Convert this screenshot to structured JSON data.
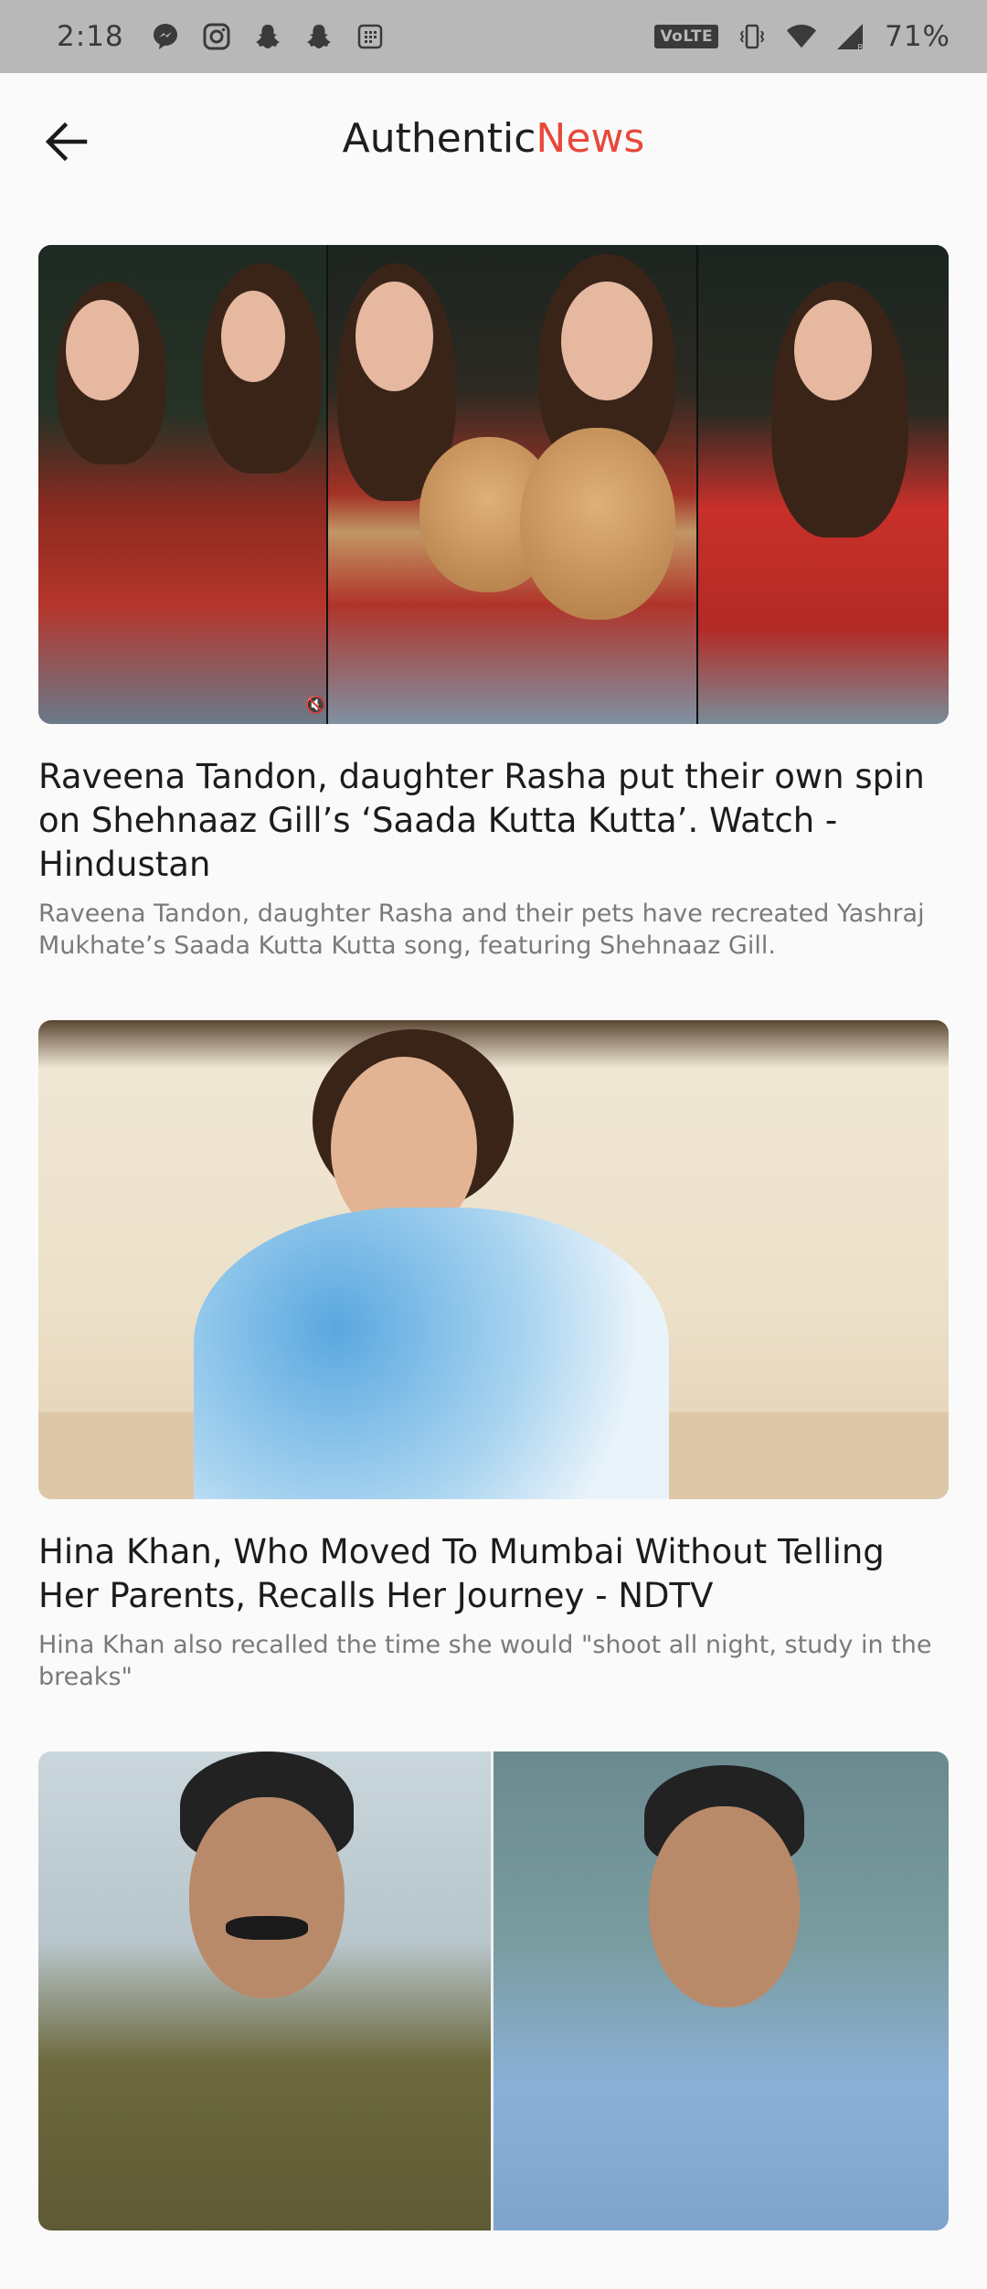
{
  "status_bar": {
    "time": "2:18",
    "volte": "VoLTE",
    "battery": "71%",
    "left_icons": [
      "messenger-icon",
      "instagram-icon",
      "snapchat-icon",
      "snapchat-icon",
      "app-grid-icon"
    ],
    "right_icons": [
      "volte-icon",
      "vibrate-icon",
      "wifi-icon",
      "signal-icon"
    ]
  },
  "app_bar": {
    "brand_part1": "Authentic",
    "brand_part2": "News",
    "accent_color": "#e8483a",
    "back_icon": "arrow-left-icon"
  },
  "articles": [
    {
      "title": "Raveena Tandon, daughter Rasha put their own spin on Shehnaaz Gill’s ‘Saada Kutta Kutta’. Watch - Hindustan",
      "description": "Raveena Tandon, daughter Rasha and their pets have recreated Yashraj Mukhate’s Saada Kutta Kutta song, featuring Shehnaaz Gill."
    },
    {
      "title": "Hina Khan, Who Moved To Mumbai Without Telling Her Parents, Recalls Her Journey - NDTV",
      "description": "Hina Khan also recalled the time she would \"shoot all night, study in the breaks\""
    },
    {
      "title": "",
      "description": ""
    }
  ]
}
